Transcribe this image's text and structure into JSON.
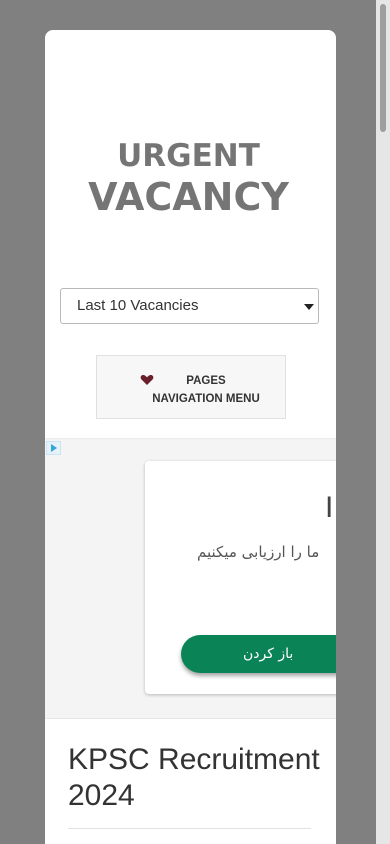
{
  "logo": {
    "line1": "URGENT",
    "line2": "VACANCY"
  },
  "vacancy_select": {
    "selected": "Last 10 Vacancies"
  },
  "nav_button": {
    "label": "PAGES NAVIGATION MENU",
    "icon": "heart-icon"
  },
  "ad": {
    "headline": "I.",
    "subtitle": "ما را ارزیابی میکنیم",
    "button_label": "باز کردن",
    "button_color": "#0a8457"
  },
  "post": {
    "title": "KPSC Recruitment 2024"
  }
}
